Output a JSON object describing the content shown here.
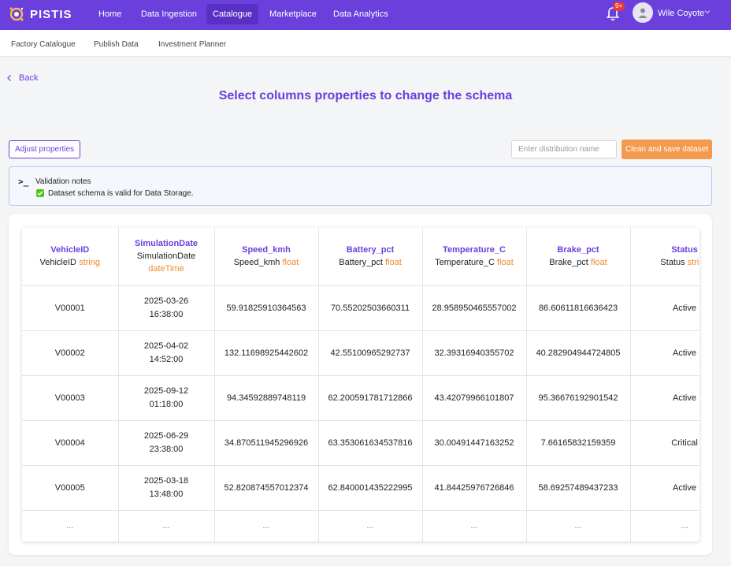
{
  "app": {
    "brand": "PISTIS",
    "nav": [
      "Home",
      "Data Ingestion",
      "Catalogue",
      "Marketplace",
      "Data Analytics"
    ],
    "active_nav": "Catalogue",
    "notification_count": "9+",
    "user_name": "Wile Coyote"
  },
  "subnav": [
    "Factory Catalogue",
    "Publish Data",
    "Investment Planner"
  ],
  "back_label": "Back",
  "page_title": "Select columns properties to change the schema",
  "actions": {
    "adjust_label": "Adjust properties",
    "distribution_placeholder": "Enter distribution name",
    "save_label": "Clean and save dataset"
  },
  "validation": {
    "title": "Validation notes",
    "message": "Dataset schema is valid for Data Storage."
  },
  "table": {
    "columns": [
      {
        "name": "VehicleID",
        "label": "VehicleID",
        "type": "string"
      },
      {
        "name": "SimulationDate",
        "label": "SimulationDate",
        "type": "dateTime"
      },
      {
        "name": "Speed_kmh",
        "label": "Speed_kmh",
        "type": "float"
      },
      {
        "name": "Battery_pct",
        "label": "Battery_pct",
        "type": "float"
      },
      {
        "name": "Temperature_C",
        "label": "Temperature_C",
        "type": "float"
      },
      {
        "name": "Brake_pct",
        "label": "Brake_pct",
        "type": "float"
      },
      {
        "name": "Status",
        "label": "Status",
        "type": "string"
      }
    ],
    "rows": [
      [
        "V00001",
        [
          "2025-03-26",
          "16:38:00"
        ],
        "59.91825910364563",
        "70.55202503660311",
        "28.958950465557002",
        "86.60611816636423",
        "Active"
      ],
      [
        "V00002",
        [
          "2025-04-02",
          "14:52:00"
        ],
        "132.11698925442602",
        "42.55100965292737",
        "32.39316940355702",
        "40.282904944724805",
        "Active"
      ],
      [
        "V00003",
        [
          "2025-09-12",
          "01:18:00"
        ],
        "94.34592889748119",
        "62.200591781712866",
        "43.42079966101807",
        "95.36676192901542",
        "Active"
      ],
      [
        "V00004",
        [
          "2025-06-29",
          "23:38:00"
        ],
        "34.870511945296926",
        "63.353061634537816",
        "30.00491447163252",
        "7.66165832159359",
        "Critical"
      ],
      [
        "V00005",
        [
          "2025-03-18",
          "13:48:00"
        ],
        "52.820874557012374",
        "62.840001435222995",
        "41.84425976726846",
        "58.69257489437233",
        "Active"
      ]
    ],
    "ellipsis": "..."
  },
  "colors": {
    "primary": "#6a3fdc",
    "accent": "#f49a4f",
    "type": "#f08a2e",
    "success": "#52c41a"
  }
}
